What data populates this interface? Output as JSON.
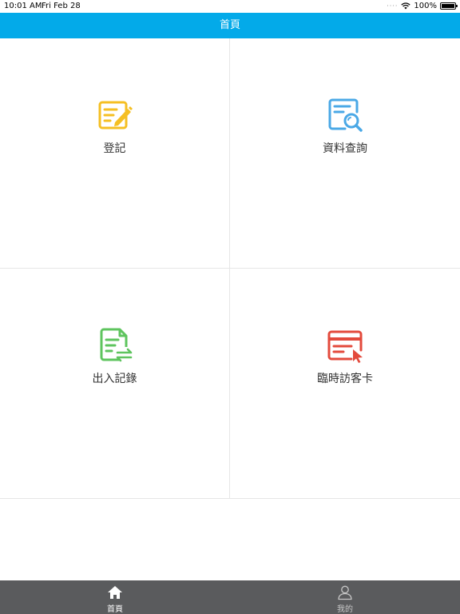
{
  "status_bar": {
    "time": "10:01 AM",
    "date": "Fri Feb 28",
    "battery": "100%",
    "battery_level": 1.0
  },
  "nav": {
    "title": "首頁"
  },
  "tiles": [
    {
      "label": "登記",
      "icon": "register-edit-icon",
      "color": "#f5bf22"
    },
    {
      "label": "資料查詢",
      "icon": "data-search-icon",
      "color": "#4aa8e6"
    },
    {
      "label": "出入記錄",
      "icon": "entry-exit-record-icon",
      "color": "#5ec45e"
    },
    {
      "label": "臨時訪客卡",
      "icon": "visitor-card-icon",
      "color": "#e34a3c"
    }
  ],
  "tab_bar": {
    "tabs": [
      {
        "label": "首頁",
        "icon": "home-icon",
        "active": true
      },
      {
        "label": "我的",
        "icon": "profile-icon",
        "active": false
      }
    ]
  },
  "colors": {
    "nav_bg": "#03aae9",
    "tab_bg": "#5a5b5d"
  }
}
